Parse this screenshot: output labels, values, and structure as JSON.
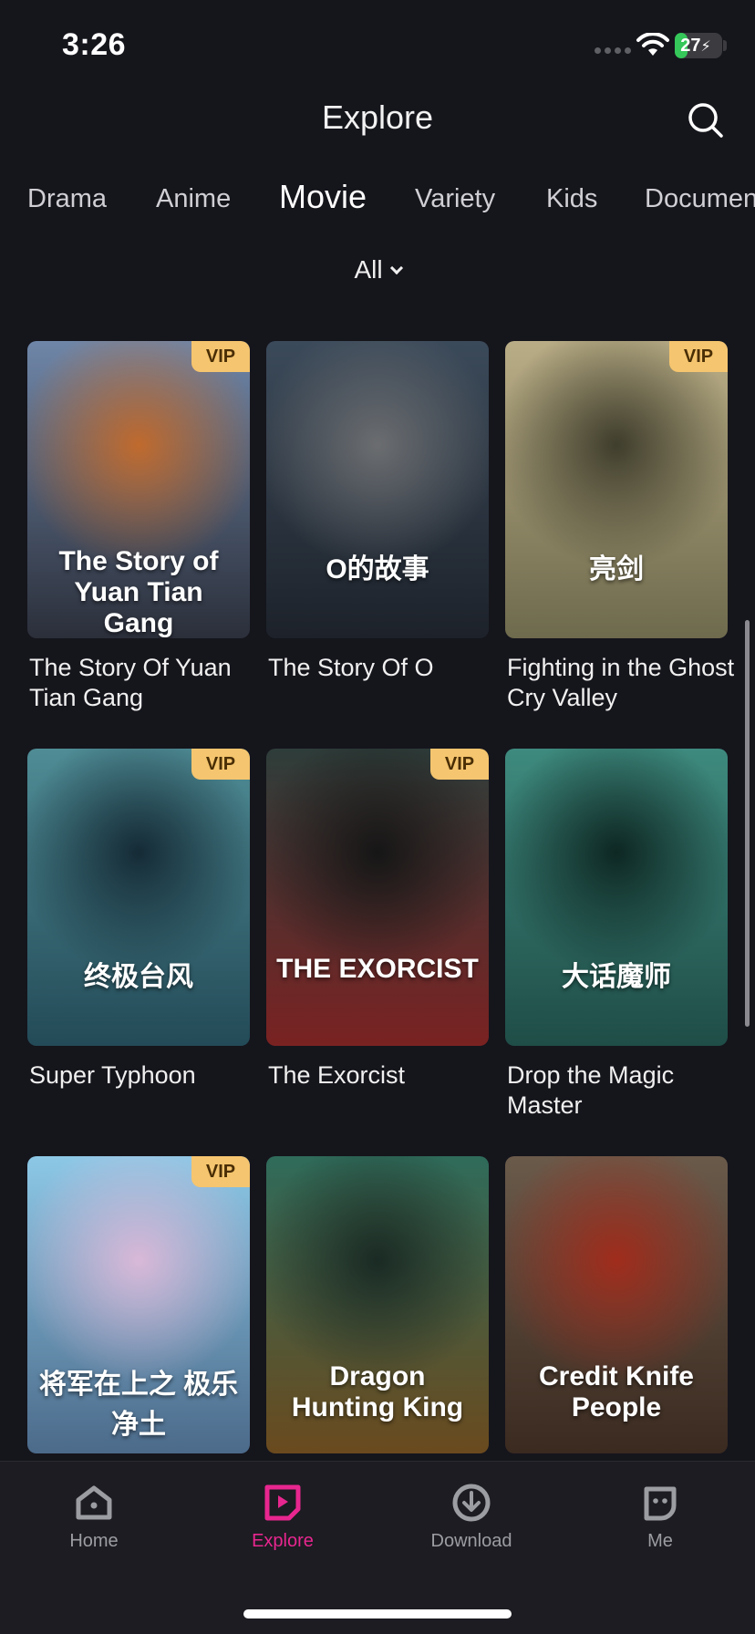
{
  "status_bar": {
    "time": "3:26",
    "battery": "27",
    "battery_level": 0.27
  },
  "header": {
    "title": "Explore"
  },
  "tabs": [
    {
      "label": "Drama"
    },
    {
      "label": "Anime"
    },
    {
      "label": "Movie"
    },
    {
      "label": "Variety"
    },
    {
      "label": "Kids"
    },
    {
      "label": "Documentary"
    }
  ],
  "filter": {
    "label": "All"
  },
  "movies": [
    {
      "title": "The Story Of Yuan Tian Gang",
      "vip": "VIP",
      "poster_text": "The Story of Yuan Tian Gang",
      "colors": [
        "#6f86a8",
        "#2b2f3a",
        "#c06a2d"
      ]
    },
    {
      "title": "The Story Of O",
      "vip": "",
      "poster_text": "O的故事",
      "colors": [
        "#3b4a5a",
        "#1d222a",
        "#6b6d70"
      ]
    },
    {
      "title": "Fighting in the Ghost Cry Valley",
      "vip": "VIP",
      "poster_text": "亮剑",
      "colors": [
        "#b9ad86",
        "#6e6a4d",
        "#3f3d2c"
      ]
    },
    {
      "title": "Super Typhoon",
      "vip": "VIP",
      "poster_text": "终极台风",
      "colors": [
        "#4f8c95",
        "#234a57",
        "#152b36"
      ]
    },
    {
      "title": "The Exorcist",
      "vip": "VIP",
      "poster_text": "THE EXORCIST",
      "colors": [
        "#2e3d3a",
        "#7a2222",
        "#161616"
      ]
    },
    {
      "title": "Drop the Magic Master",
      "vip": "",
      "poster_text": "大话魔师",
      "colors": [
        "#3e8a7e",
        "#1f4d47",
        "#0e2723"
      ]
    },
    {
      "title": "",
      "vip": "VIP",
      "poster_text": "将军在上之 极乐净土",
      "colors": [
        "#8cc8e6",
        "#4c6a8a",
        "#d9b8d8"
      ]
    },
    {
      "title": "",
      "vip": "",
      "poster_text": "Dragon Hunting King",
      "colors": [
        "#2f6b5a",
        "#6a4a1e",
        "#1a2a24"
      ]
    },
    {
      "title": "",
      "vip": "",
      "poster_text": "Credit Knife People",
      "colors": [
        "#6a5a4a",
        "#3a2a20",
        "#a02c1c"
      ]
    }
  ],
  "bottom_nav": [
    {
      "label": "Home",
      "icon": "home-icon"
    },
    {
      "label": "Explore",
      "icon": "explore-icon"
    },
    {
      "label": "Download",
      "icon": "download-icon"
    },
    {
      "label": "Me",
      "icon": "me-icon"
    }
  ],
  "colors": {
    "accent": "#e8268f",
    "vip_bg": "#f5c56f",
    "background": "#15151c"
  }
}
